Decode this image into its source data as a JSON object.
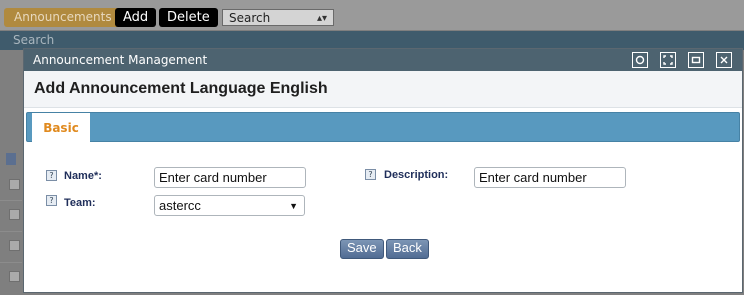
{
  "background": {
    "tab_label": "Announcements",
    "add_label": "Add",
    "delete_label": "Delete",
    "search_select_value": "Search",
    "search_bar_label": "Search"
  },
  "dialog": {
    "title": "Announcement Management",
    "header": "Add Announcement Language English",
    "tabs": [
      {
        "label": "Basic"
      }
    ],
    "fields": {
      "name": {
        "label": "Name*:",
        "value": "Enter card number"
      },
      "description": {
        "label": "Description:",
        "value": "Enter card number"
      },
      "team": {
        "label": "Team:",
        "value": "astercc"
      }
    },
    "buttons": {
      "save": "Save",
      "back": "Back"
    }
  }
}
